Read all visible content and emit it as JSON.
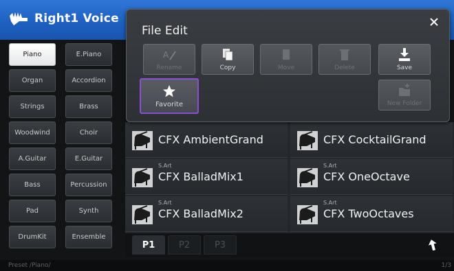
{
  "header": {
    "title": "Right1 Voice",
    "icon": "keyboard-hand-icon"
  },
  "categories": [
    [
      "Piano",
      "E.Piano"
    ],
    [
      "Organ",
      "Accordion"
    ],
    [
      "Strings",
      "Brass"
    ],
    [
      "Woodwind",
      "Choir"
    ],
    [
      "A.Guitar",
      "E.Guitar"
    ],
    [
      "Bass",
      "Percussion"
    ],
    [
      "Pad",
      "Synth"
    ],
    [
      "DrumKit",
      "Ensemble"
    ]
  ],
  "selected_category": "Piano",
  "voices": [
    {
      "sub": "",
      "name": "CFX AmbientGrand"
    },
    {
      "sub": "",
      "name": "CFX CocktailGrand"
    },
    {
      "sub": "S.Art",
      "name": "CFX BalladMix1"
    },
    {
      "sub": "S.Art",
      "name": "CFX OneOctave"
    },
    {
      "sub": "S.Art",
      "name": "CFX BalladMix2"
    },
    {
      "sub": "S.Art",
      "name": "CFX TwoOctaves"
    }
  ],
  "pages": {
    "tabs": [
      "P1",
      "P2",
      "P3"
    ],
    "active": "P1"
  },
  "status": {
    "path": "Preset /Piano/",
    "page_counter": "1/3"
  },
  "dialog": {
    "title": "File Edit",
    "buttons": [
      {
        "label": "Rename",
        "enabled": false,
        "icon": "rename-icon"
      },
      {
        "label": "Copy",
        "enabled": true,
        "icon": "copy-icon"
      },
      {
        "label": "Move",
        "enabled": false,
        "icon": "move-icon"
      },
      {
        "label": "Delete",
        "enabled": false,
        "icon": "delete-icon"
      },
      {
        "label": "Save",
        "enabled": true,
        "icon": "save-icon"
      },
      {
        "label": "Favorite",
        "enabled": true,
        "icon": "star-icon"
      },
      {
        "label": "New Folder",
        "enabled": false,
        "icon": "new-folder-icon"
      }
    ]
  },
  "colors": {
    "header": "#1d5fbf",
    "favorite_outline": "#8a4fd3",
    "selected_category": "#ffffff"
  }
}
